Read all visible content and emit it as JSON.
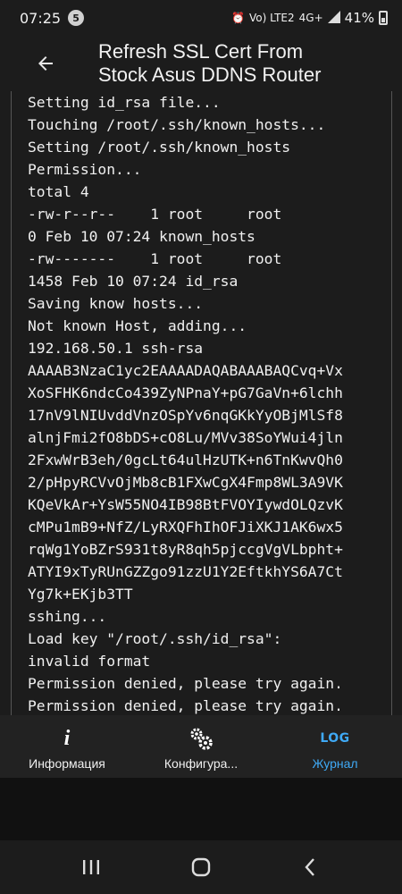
{
  "status_bar": {
    "time": "07:25",
    "notification_count": "5",
    "network": "Vo) LTE2",
    "signal_type": "4G+",
    "battery_pct": "41%"
  },
  "app_bar": {
    "title_line1": "Refresh SSL Cert From",
    "title_line2": "Stock Asus DDNS Router"
  },
  "log": {
    "lines": [
      "Setting id_rsa file...",
      "Touching /root/.ssh/known_hosts...",
      "Setting /root/.ssh/known_hosts",
      "Permission...",
      "total 4",
      "-rw-r--r--    1 root     root",
      "0 Feb 10 07:24 known_hosts",
      "-rw-------    1 root     root",
      "1458 Feb 10 07:24 id_rsa",
      "Saving know hosts...",
      "Not known Host, adding...",
      "192.168.50.1 ssh-rsa",
      "AAAAB3NzaC1yc2EAAAADAQABAAABAQCvq+Vx",
      "XoSFHK6ndcCo439ZyNPnaY+pG7GaVn+6lchh",
      "17nV9lNIUvddVnzOSpYv6nqGKkYyOBjMlSf8",
      "alnjFmi2fO8bDS+cO8Lu/MVv38SoYWui4jln",
      "2FxwWrB3eh/0gcLt64ulHzUTK+n6TnKwvQh0",
      "2/pHpyRCVvOjMb8cB1FXwCgX4Fmp8WL3A9VK",
      "KQeVkAr+YsW55NO4IB98BtFVOYIywdOLQzvK",
      "cMPu1mB9+NfZ/LyRXQFhIhOFJiXKJ1AK6wx5",
      "rqWg1YoBZrS931t8yR8qh5pjccgVgVLbpht+",
      "ATYI9xTyRUnGZZgo91zzU1Y2EftkhYS6A7Ct",
      "Yg7k+EKjb3TT",
      "sshing...",
      "Load key \"/root/.ssh/id_rsa\":",
      "invalid format",
      "Permission denied, please try again.",
      "Permission denied, please try again."
    ]
  },
  "bottom_nav": {
    "info_label": "Информация",
    "config_label": "Конфигура...",
    "log_label": "Журнал",
    "log_icon_text": "LOG",
    "info_icon_text": "i",
    "active_color": "#3fa9f5"
  },
  "icons": {
    "back": "arrow-left-icon",
    "info": "info-icon",
    "config": "gears-icon",
    "log": "log-icon",
    "recents": "recents-icon",
    "home": "home-icon",
    "back_sys": "chevron-left-icon"
  }
}
